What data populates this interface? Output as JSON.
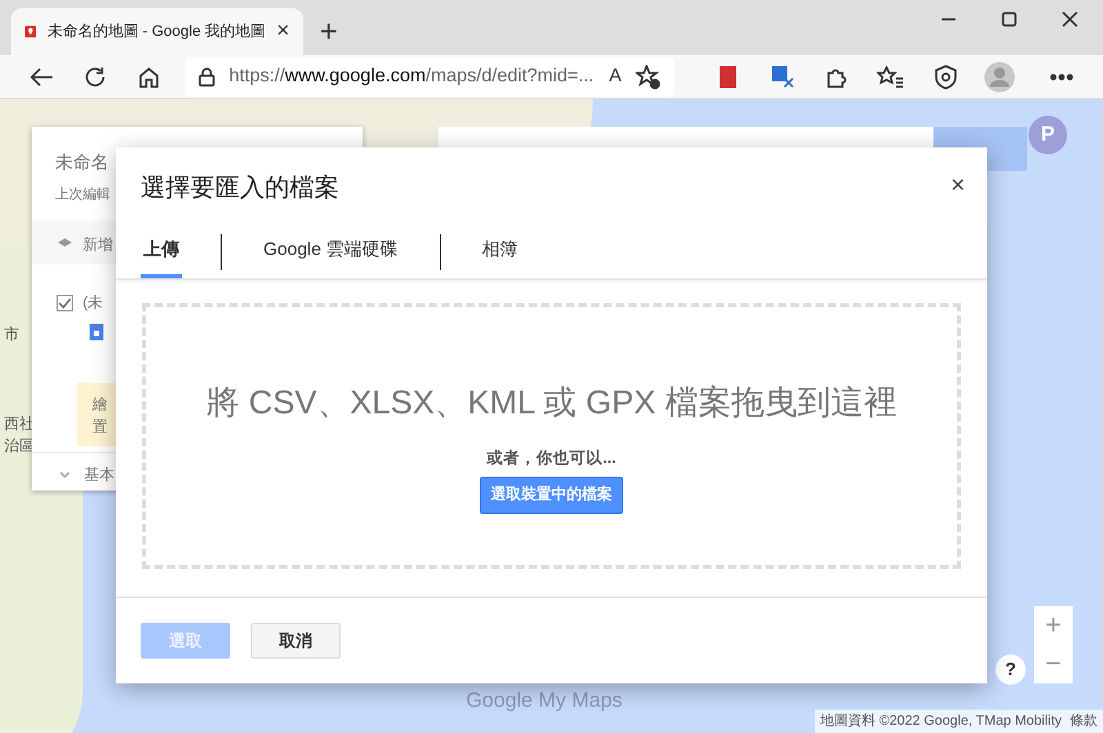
{
  "browser": {
    "tab_title": "未命名的地圖 - Google 我的地圖",
    "tab_close": "×",
    "new_tab": "+",
    "url_scheme": "https://",
    "url_host": "www.google.com",
    "url_path": "/maps/d/edit?mid=...",
    "read_aloud": "A"
  },
  "map_panel": {
    "title": "未命名",
    "subtitle": "上次編輯",
    "add_layer": "新增",
    "layer_checked": true,
    "layer_name": "(未",
    "notice_line1": "繪",
    "notice_line2": "置",
    "basemap": "基本"
  },
  "map": {
    "labels": [
      "市",
      "西社",
      "治區"
    ],
    "avatar": "P",
    "logo": "Google My Maps",
    "zoom_in": "+",
    "zoom_out": "−",
    "help": "?",
    "attribution": "地圖資料 ©2022 Google, TMap Mobility",
    "terms": "條款"
  },
  "dialog": {
    "title": "選擇要匯入的檔案",
    "close": "×",
    "tabs": [
      {
        "label": "上傳",
        "selected": true
      },
      {
        "label": "Google 雲端硬碟",
        "selected": false
      },
      {
        "label": "相簿",
        "selected": false
      }
    ],
    "drop_text": "將 CSV、XLSX、KML 或 GPX 檔案拖曳到這裡",
    "or_text": "或者，你也可以...",
    "choose_button": "選取裝置中的檔案",
    "buttons": [
      {
        "label": "選取",
        "kind": "primary",
        "disabled": true
      },
      {
        "label": "取消",
        "kind": "secondary",
        "disabled": false
      }
    ]
  }
}
